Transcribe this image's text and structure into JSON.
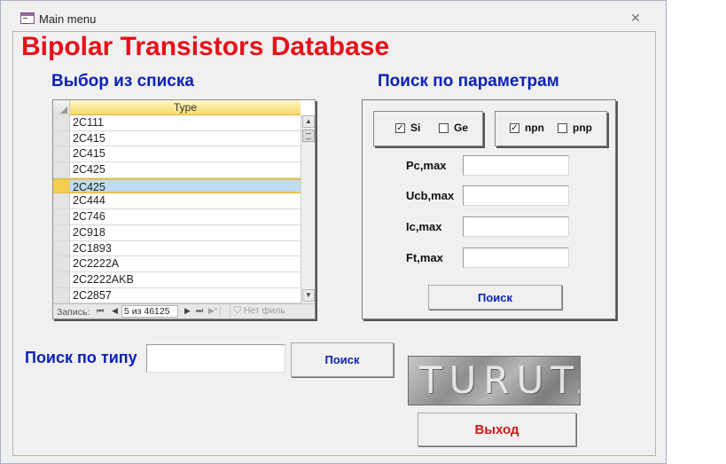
{
  "window": {
    "title": "Main menu"
  },
  "app_title": "Bipolar Transistors Database",
  "list_section": {
    "title": "Выбор из списка",
    "column_header": "Type",
    "rows": [
      "2C111",
      "2C415",
      "2C415",
      "2C425",
      "2C425",
      "2C444",
      "2C746",
      "2C918",
      "2C1893",
      "2C2222A",
      "2C2222AKB",
      "2C2857"
    ],
    "current_row_index": 4,
    "navigation": {
      "records_label": "Запись:",
      "first": "⏮",
      "prev": "◀",
      "counter": "5 из 46125",
      "next": "▶",
      "last": "⏭",
      "new": "▶*",
      "filter_label": "Нет филь"
    }
  },
  "param_section": {
    "title": "Поиск по параметрам",
    "material": [
      {
        "label": "Si",
        "checked": true
      },
      {
        "label": "Ge",
        "checked": false
      }
    ],
    "polarity": [
      {
        "label": "npn",
        "checked": true
      },
      {
        "label": "pnp",
        "checked": false
      }
    ],
    "fields": [
      {
        "label": "Pc,max",
        "value": ""
      },
      {
        "label": "Ucb,max",
        "value": ""
      },
      {
        "label": "Ic,max",
        "value": ""
      },
      {
        "label": "Ft,max",
        "value": ""
      }
    ],
    "search_button": "Поиск"
  },
  "type_search": {
    "label": "Поиск по типу",
    "value": "",
    "button": "Поиск"
  },
  "logo": {
    "text": "TURUTA"
  },
  "exit_button": "Выход",
  "colors": {
    "title_red": "#e8101a",
    "heading_blue": "#0b22b8",
    "button_blue": "#0b22b8",
    "exit_red": "#d01818"
  }
}
